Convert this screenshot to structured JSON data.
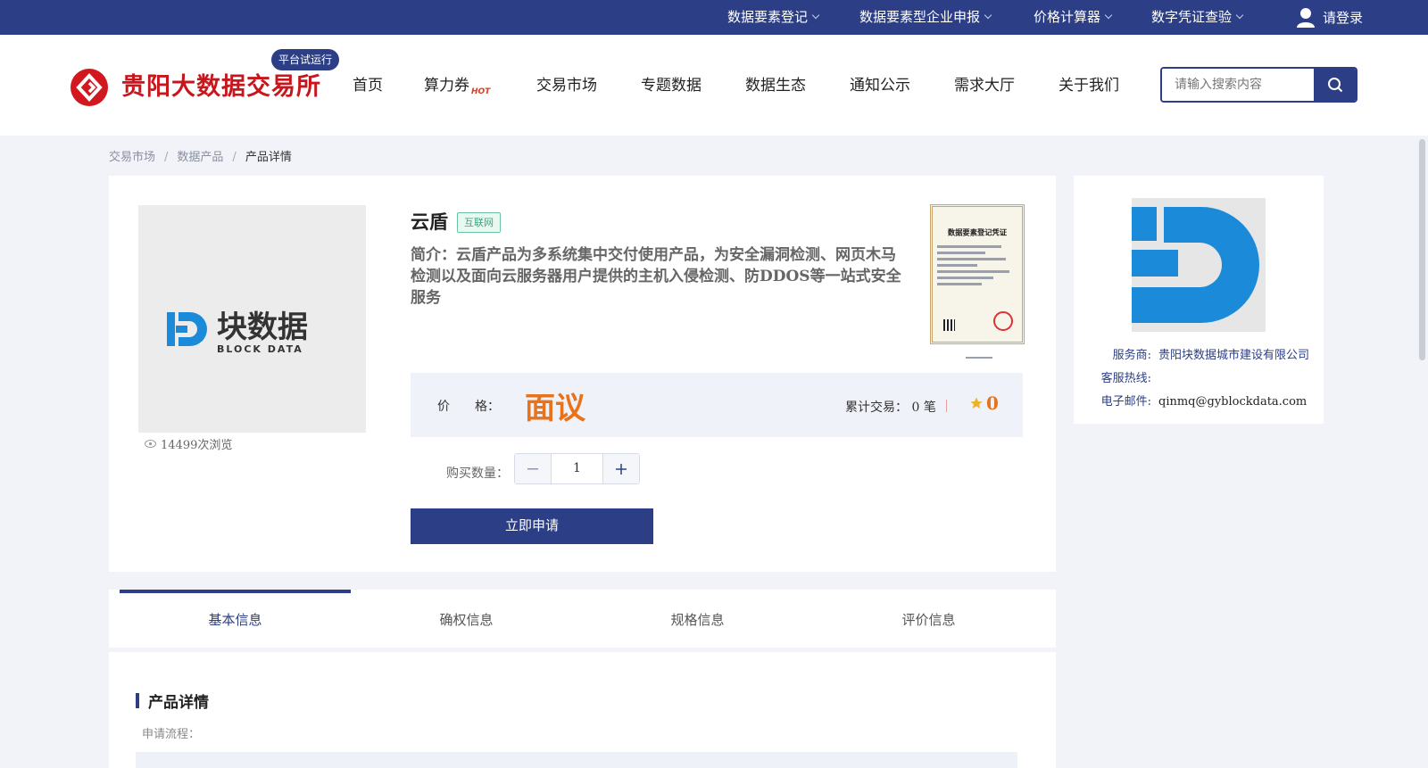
{
  "topbar": {
    "links": [
      {
        "label": "数据要素登记"
      },
      {
        "label": "数据要素型企业申报"
      },
      {
        "label": "价格计算器"
      },
      {
        "label": "数字凭证查验"
      }
    ],
    "login_label": "请登录"
  },
  "header": {
    "brand": "贵阳大数据交易所",
    "trial_badge": "平台试运行",
    "nav": [
      {
        "label": "首页"
      },
      {
        "label": "算力券",
        "badge": "HOT"
      },
      {
        "label": "交易市场"
      },
      {
        "label": "专题数据"
      },
      {
        "label": "数据生态"
      },
      {
        "label": "通知公示"
      },
      {
        "label": "需求大厅"
      },
      {
        "label": "关于我们"
      }
    ],
    "search_placeholder": "请输入搜索内容"
  },
  "breadcrumb": {
    "items": [
      "交易市场",
      "数据产品",
      "产品详情"
    ],
    "separator": "/"
  },
  "product": {
    "title": "云盾",
    "tag": "互联网",
    "description": "简介：云盾产品为多系统集中交付使用产品，为安全漏洞检测、网页木马检测以及面向云服务器用户提供的主机入侵检测、防DDOS等一站式安全服务",
    "views": "14499次浏览",
    "image_logo_text": "块数据",
    "image_logo_sub": "BLOCK DATA",
    "certificate_title": "数据要素登记凭证",
    "price_label": "价　　格：",
    "price_value": "面议",
    "deal_label": "累计交易：",
    "deal_value": "0",
    "deal_unit": "笔",
    "rating": "0",
    "quantity_label": "购买数量：",
    "quantity": "1",
    "apply_label": "立即申请"
  },
  "vendor": {
    "provider_label": "服务商:",
    "provider": "贵阳块数据城市建设有限公司",
    "hotline_label": "客服热线:",
    "hotline": "",
    "email_label": "电子邮件:",
    "email": "qinmq@gyblockdata.com"
  },
  "tabs": {
    "items": [
      "基本信息",
      "确权信息",
      "规格信息",
      "评价信息"
    ],
    "active": "基本信息"
  },
  "details": {
    "title": "产品详情",
    "subtitle": "申请流程："
  },
  "colors": {
    "primary": "#2b3e86",
    "brand_red": "#c8161d",
    "price_orange": "#e8731a"
  }
}
